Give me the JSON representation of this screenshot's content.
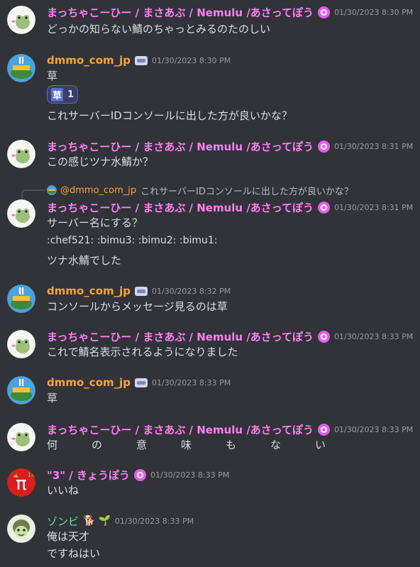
{
  "users": {
    "matcha": "まっちゃこーひー / まさあぶ / Nemulu /あさってぽう",
    "dmmo": "dmmo_com_jp",
    "kyou": "\"3\" / きょうぽう",
    "zonbi": "ゾンビ"
  },
  "messages": [
    {
      "time": "01/30/2023 8:30 PM",
      "lines": [
        "どっかの知らない鯖のちゃっとみるのたのしい"
      ]
    },
    {
      "time": "01/30/2023 8:30 PM",
      "lines": [
        "草",
        "これサーバーIDコンソールに出した方が良いかな？"
      ],
      "reaction": {
        "emoji": "草",
        "count": "1"
      }
    },
    {
      "time": "01/30/2023 8:31 PM",
      "lines": [
        "この感じツナ水鯖か？"
      ]
    },
    {
      "time": "01/30/2023 8:31 PM",
      "reply": {
        "name": "@dmmo_com_jp",
        "text": "これサーバーIDコンソールに出した方が良いかな？"
      },
      "lines": [
        "サーバー名にする？",
        ":chef521: :bimu3: :bimu2: :bimu1:",
        "ツナ水鯖でした"
      ]
    },
    {
      "time": "01/30/2023 8:32 PM",
      "lines": [
        "コンソールからメッセージ見るのは草"
      ]
    },
    {
      "time": "01/30/2023 8:33 PM",
      "lines": [
        "これで鯖名表示されるようになりました"
      ]
    },
    {
      "time": "01/30/2023 8:33 PM",
      "lines": [
        "草"
      ]
    },
    {
      "time": "01/30/2023 8:33 PM",
      "lines": [
        "何の意味もない"
      ]
    },
    {
      "time": "01/30/2023 8:33 PM",
      "lines": [
        "いいね"
      ]
    },
    {
      "time": "01/30/2023 8:33 PM",
      "lines": [
        "俺は天才",
        "ですねはい"
      ]
    }
  ],
  "colors": {
    "matcha": "#ff7ef4",
    "dmmo": "#f7a637",
    "zonbi": "#5ee2a7",
    "bg": "#313338"
  }
}
